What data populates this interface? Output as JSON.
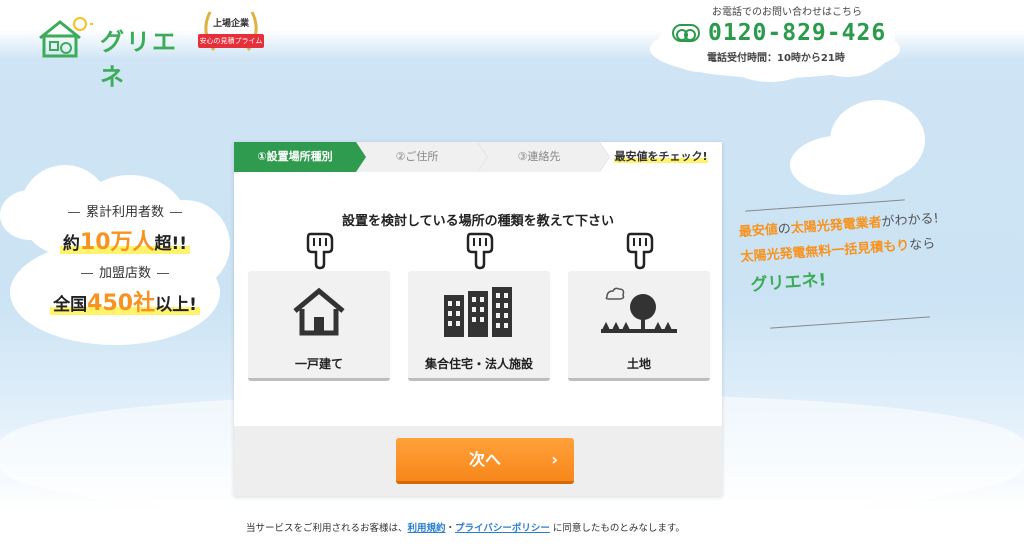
{
  "header": {
    "logo_text": "グリエネ",
    "badge_title": "上場企業",
    "badge_ribbon": "安心の見積プライム",
    "phone_caption": "お電話でのお問い合わせはこちら",
    "phone_number": "0120-829-426",
    "phone_hours": "電話受付時間：10時から21時"
  },
  "stats": {
    "users_label": "累計利用者数",
    "users_prefix": "約",
    "users_value": "10万人",
    "users_suffix": "超!!",
    "stores_label": "加盟店数",
    "stores_prefix": "全国",
    "stores_value": "450社",
    "stores_suffix": "以上!"
  },
  "tagline": {
    "line1_a": "最安値",
    "line1_b": "の",
    "line1_c": "太陽光発電業者",
    "line1_d": "がわかる!",
    "line2_a": "太陽光発電無料一括見積もり",
    "line2_b": "なら",
    "line3": "グリエネ!"
  },
  "steps": [
    {
      "label": "①設置場所種別"
    },
    {
      "label": "②ご住所"
    },
    {
      "label": "③連絡先"
    },
    {
      "label": "最安値をチェック!"
    }
  ],
  "question": "設置を検討している場所の種類を教えて下さい",
  "choices": [
    {
      "label": "一戸建て",
      "icon": "house-icon"
    },
    {
      "label": "集合住宅・法人施設",
      "icon": "building-icon"
    },
    {
      "label": "土地",
      "icon": "land-icon"
    }
  ],
  "next_button": {
    "label": "次へ",
    "chevron": "›"
  },
  "consent": {
    "prefix": "当サービスをご利用されるお客様は、",
    "terms_link": "利用規約",
    "separator": "・",
    "privacy_link": "プライバシーポリシー",
    "suffix": " に同意したものとみなします。"
  },
  "colors": {
    "brand_green": "#2e9b4e",
    "accent_orange": "#f7931e",
    "link_blue": "#2b7fcf"
  }
}
